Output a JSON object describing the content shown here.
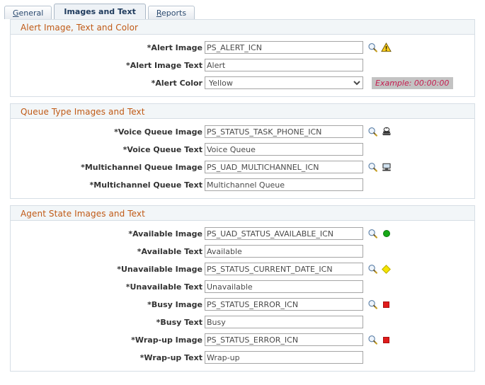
{
  "tabs": [
    {
      "name": "tab-general",
      "label": "General",
      "accel": "G",
      "active": false
    },
    {
      "name": "tab-images-and-text",
      "label": "Images and Text",
      "accel": "",
      "active": true
    },
    {
      "name": "tab-reports",
      "label": "Reports",
      "accel": "R",
      "active": false
    }
  ],
  "sections": [
    {
      "id": "alert",
      "title": "Alert Image, Text and Color",
      "fields": [
        {
          "name": "alert-image",
          "label": "*Alert Image",
          "control": "text",
          "value": "PS_ALERT_ICN",
          "placeholder": "",
          "lookup": true,
          "icon": "warning-triangle-icon",
          "example": ""
        },
        {
          "name": "alert-image-text",
          "label": "*Alert Image Text",
          "control": "text",
          "value": "Alert",
          "placeholder": "",
          "lookup": false,
          "icon": "",
          "example": ""
        },
        {
          "name": "alert-color",
          "label": "*Alert Color",
          "control": "select",
          "value": "Yellow",
          "options": [
            "Yellow"
          ],
          "lookup": false,
          "icon": "",
          "example": "Example: 00:00:00"
        }
      ]
    },
    {
      "id": "queue-type",
      "title": "Queue Type Images and Text",
      "fields": [
        {
          "name": "voice-queue-image",
          "label": "*Voice Queue Image",
          "control": "text",
          "value": "PS_STATUS_TASK_PHONE_ICN",
          "placeholder": "",
          "lookup": true,
          "icon": "telephone-icon",
          "example": ""
        },
        {
          "name": "voice-queue-text",
          "label": "*Voice Queue Text",
          "control": "text",
          "value": "Voice Queue",
          "placeholder": "",
          "lookup": false,
          "icon": "",
          "example": ""
        },
        {
          "name": "multichannel-queue-image",
          "label": "*Multichannel Queue Image",
          "control": "text",
          "value": "PS_UAD_MULTICHANNEL_ICN",
          "placeholder": "",
          "lookup": true,
          "icon": "computer-monitor-icon",
          "example": ""
        },
        {
          "name": "multichannel-queue-text",
          "label": "*Multichannel Queue Text",
          "control": "text",
          "value": "Multichannel Queue",
          "placeholder": "",
          "lookup": false,
          "icon": "",
          "example": ""
        }
      ]
    },
    {
      "id": "agent-state",
      "title": "Agent State Images and Text",
      "fields": [
        {
          "name": "available-image",
          "label": "*Available Image",
          "control": "text",
          "value": "PS_UAD_STATUS_AVAILABLE_ICN",
          "placeholder": "",
          "lookup": true,
          "icon": "green-circle-icon",
          "example": ""
        },
        {
          "name": "available-text",
          "label": "*Available Text",
          "control": "text",
          "value": "Available",
          "placeholder": "",
          "lookup": false,
          "icon": "",
          "example": ""
        },
        {
          "name": "unavailable-image",
          "label": "*Unavailable Image",
          "control": "text",
          "value": "PS_STATUS_CURRENT_DATE_ICN",
          "placeholder": "",
          "lookup": true,
          "icon": "yellow-diamond-icon",
          "example": ""
        },
        {
          "name": "unavailable-text",
          "label": "*Unavailable Text",
          "control": "text",
          "value": "Unavailable",
          "placeholder": "",
          "lookup": false,
          "icon": "",
          "example": ""
        },
        {
          "name": "busy-image",
          "label": "*Busy Image",
          "control": "text",
          "value": "PS_STATUS_ERROR_ICN",
          "placeholder": "",
          "lookup": true,
          "icon": "red-square-icon",
          "example": ""
        },
        {
          "name": "busy-text",
          "label": "*Busy Text",
          "control": "text",
          "value": "Busy",
          "placeholder": "",
          "lookup": false,
          "icon": "",
          "example": ""
        },
        {
          "name": "wrap-up-image",
          "label": "*Wrap-up Image",
          "control": "text",
          "value": "PS_STATUS_ERROR_ICN",
          "placeholder": "",
          "lookup": true,
          "icon": "red-square-icon",
          "example": ""
        },
        {
          "name": "wrap-up-text",
          "label": "*Wrap-up Text",
          "control": "text",
          "value": "Wrap-up",
          "placeholder": "",
          "lookup": false,
          "icon": "",
          "example": ""
        }
      ]
    }
  ],
  "colors": {
    "section_title": "#c05a16",
    "section_header_bg": "#f2f6f8",
    "tab_text": "#2b4a6f",
    "example_text": "#c51b4e",
    "example_bg": "#c3c3c3",
    "available": "#17a817",
    "unavailable": "#f5e400",
    "busy": "#e01b1b"
  }
}
